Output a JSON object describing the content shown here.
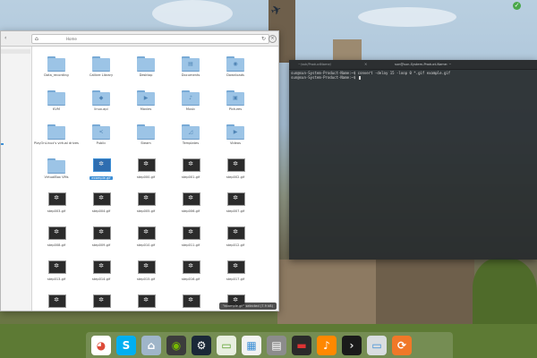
{
  "file_manager": {
    "breadcrumb_home": "⌂",
    "breadcrumb_path": "Home",
    "reload": "↻",
    "close": "×",
    "items": [
      {
        "label": "Data_recording",
        "kind": "folder",
        "icon": "folder-icon",
        "glyph": ""
      },
      {
        "label": "Calibre Library",
        "kind": "folder",
        "icon": "folder-icon",
        "glyph": ""
      },
      {
        "label": "Desktop",
        "kind": "folder",
        "icon": "folder-icon",
        "glyph": ""
      },
      {
        "label": "Documents",
        "kind": "folder",
        "icon": "documents-folder-icon",
        "glyph": "▤"
      },
      {
        "label": "Downloads",
        "kind": "folder",
        "icon": "downloads-folder-icon",
        "glyph": "◉"
      },
      {
        "label": "KVM",
        "kind": "folder",
        "icon": "folder-icon",
        "glyph": ""
      },
      {
        "label": "linux.api",
        "kind": "folder",
        "icon": "folder-icon",
        "glyph": "◆"
      },
      {
        "label": "Movies",
        "kind": "folder",
        "icon": "movies-folder-icon",
        "glyph": "▶"
      },
      {
        "label": "Music",
        "kind": "folder",
        "icon": "music-folder-icon",
        "glyph": "♪"
      },
      {
        "label": "Pictures",
        "kind": "folder",
        "icon": "pictures-folder-icon",
        "glyph": "▣"
      },
      {
        "label": "PlayOnLinux's virtual drives",
        "kind": "folder",
        "icon": "folder-icon",
        "glyph": ""
      },
      {
        "label": "Public",
        "kind": "folder",
        "icon": "public-folder-icon",
        "glyph": "<"
      },
      {
        "label": "Steam",
        "kind": "folder",
        "icon": "folder-icon",
        "glyph": ""
      },
      {
        "label": "Templates",
        "kind": "folder",
        "icon": "templates-folder-icon",
        "glyph": "◿"
      },
      {
        "label": "Videos",
        "kind": "folder",
        "icon": "videos-folder-icon",
        "glyph": "▶"
      },
      {
        "label": "VirtualBox VMs",
        "kind": "folder",
        "icon": "folder-icon",
        "glyph": ""
      },
      {
        "label": "example.gif",
        "kind": "gif",
        "icon": "gif-thumbnail-icon",
        "glyph": "✲",
        "selected": true
      },
      {
        "label": "step000.gif",
        "kind": "gif",
        "icon": "gif-thumbnail-icon",
        "glyph": "✲"
      },
      {
        "label": "step001.gif",
        "kind": "gif",
        "icon": "gif-thumbnail-icon",
        "glyph": "✲"
      },
      {
        "label": "step002.gif",
        "kind": "gif",
        "icon": "gif-thumbnail-icon",
        "glyph": "✲"
      },
      {
        "label": "step003.gif",
        "kind": "gif",
        "icon": "gif-thumbnail-icon",
        "glyph": "✲"
      },
      {
        "label": "step004.gif",
        "kind": "gif",
        "icon": "gif-thumbnail-icon",
        "glyph": "✲"
      },
      {
        "label": "step005.gif",
        "kind": "gif",
        "icon": "gif-thumbnail-icon",
        "glyph": "✲"
      },
      {
        "label": "step006.gif",
        "kind": "gif",
        "icon": "gif-thumbnail-icon",
        "glyph": "✲"
      },
      {
        "label": "step007.gif",
        "kind": "gif",
        "icon": "gif-thumbnail-icon",
        "glyph": "✲"
      },
      {
        "label": "step008.gif",
        "kind": "gif",
        "icon": "gif-thumbnail-icon",
        "glyph": "✲"
      },
      {
        "label": "step009.gif",
        "kind": "gif",
        "icon": "gif-thumbnail-icon",
        "glyph": "✲"
      },
      {
        "label": "step010.gif",
        "kind": "gif",
        "icon": "gif-thumbnail-icon",
        "glyph": "✲"
      },
      {
        "label": "step011.gif",
        "kind": "gif",
        "icon": "gif-thumbnail-icon",
        "glyph": "✲"
      },
      {
        "label": "step012.gif",
        "kind": "gif",
        "icon": "gif-thumbnail-icon",
        "glyph": "✲"
      },
      {
        "label": "step013.gif",
        "kind": "gif",
        "icon": "gif-thumbnail-icon",
        "glyph": "✲"
      },
      {
        "label": "step014.gif",
        "kind": "gif",
        "icon": "gif-thumbnail-icon",
        "glyph": "✲"
      },
      {
        "label": "step015.gif",
        "kind": "gif",
        "icon": "gif-thumbnail-icon",
        "glyph": "✲"
      },
      {
        "label": "step016.gif",
        "kind": "gif",
        "icon": "gif-thumbnail-icon",
        "glyph": "✲"
      },
      {
        "label": "step017.gif",
        "kind": "gif",
        "icon": "gif-thumbnail-icon",
        "glyph": "✲"
      },
      {
        "label": "",
        "kind": "gif",
        "icon": "gif-thumbnail-icon",
        "glyph": "✲"
      },
      {
        "label": "",
        "kind": "gif",
        "icon": "gif-thumbnail-icon",
        "glyph": "✲"
      },
      {
        "label": "",
        "kind": "gif",
        "icon": "gif-thumbnail-icon",
        "glyph": "✲"
      },
      {
        "label": "",
        "kind": "gif",
        "icon": "gif-thumbnail-icon",
        "glyph": "✲"
      },
      {
        "label": "",
        "kind": "gif",
        "icon": "gif-thumbnail-icon",
        "glyph": "✲"
      }
    ],
    "status": "\"example.gif\" selected (7.9 kB)"
  },
  "terminal": {
    "tab_label": "~/ssh/ProductName/",
    "tab_close": "×",
    "window_title": "sun@sun-System-Product-Name: ~",
    "lines": [
      "sun@sun-System-Product-Name:~$ convert -delay 15 -loop 0 *.gif example.gif",
      "sun@sun-System-Product-Name:~$ "
    ]
  },
  "dock": {
    "items": [
      {
        "name": "chrome-icon",
        "color": "#ffffff",
        "symbol": "◕",
        "fg": "#dd4b39"
      },
      {
        "name": "skype-icon",
        "color": "#00aff0",
        "symbol": "S",
        "fg": "#ffffff"
      },
      {
        "name": "files-icon",
        "color": "#9fb5c9",
        "symbol": "⌂",
        "fg": "#ffffff"
      },
      {
        "name": "nvidia-icon",
        "color": "#3c3c3c",
        "symbol": "◉",
        "fg": "#76b900"
      },
      {
        "name": "steam-icon",
        "color": "#1b2838",
        "symbol": "⚙",
        "fg": "#ffffff"
      },
      {
        "name": "system-monitor-icon",
        "color": "#e8efe0",
        "symbol": "▭",
        "fg": "#5aa02c"
      },
      {
        "name": "text-editor-icon",
        "color": "#f2f2f2",
        "symbol": "▦",
        "fg": "#3d8fd6"
      },
      {
        "name": "settings-icon",
        "color": "#8c8c8c",
        "symbol": "▤",
        "fg": "#ffffff"
      },
      {
        "name": "screen-recorder-icon",
        "color": "#2a2a2a",
        "symbol": "▬",
        "fg": "#d33"
      },
      {
        "name": "vlc-icon",
        "color": "#ff8800",
        "symbol": "♪",
        "fg": "#ffffff"
      },
      {
        "name": "terminal-icon",
        "color": "#1a1a1a",
        "symbol": "›",
        "fg": "#e8e8e8"
      },
      {
        "name": "screenshot-icon",
        "color": "#d9dde0",
        "symbol": "▭",
        "fg": "#3d8fd6"
      },
      {
        "name": "update-icon",
        "color": "#f07828",
        "symbol": "⟳",
        "fg": "#ffffff"
      }
    ]
  }
}
